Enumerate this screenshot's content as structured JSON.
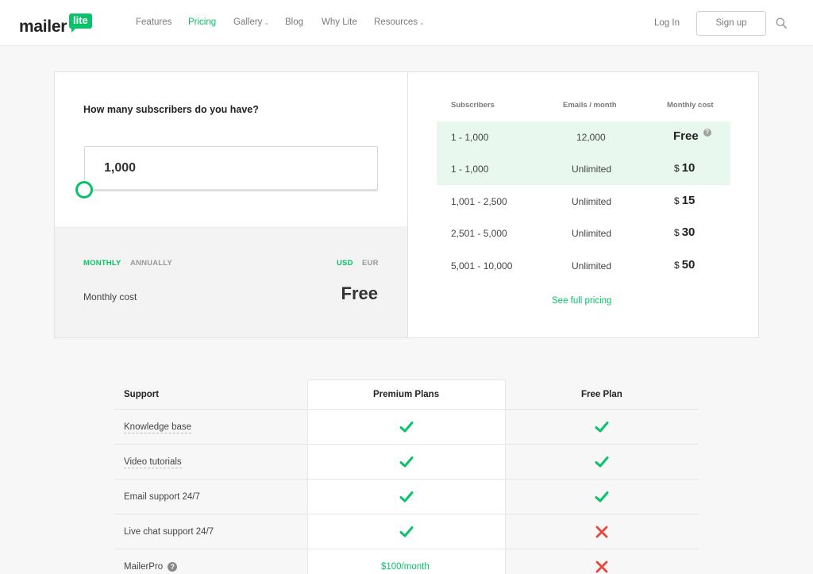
{
  "brand": {
    "logo_text": "mailer",
    "logo_badge": "lite",
    "accent": "#09c269"
  },
  "nav": {
    "items": [
      {
        "label": "Features",
        "active": false
      },
      {
        "label": "Pricing",
        "active": true
      },
      {
        "label": "Gallery",
        "active": false,
        "dropdown": true
      },
      {
        "label": "Blog",
        "active": false
      },
      {
        "label": "Why Lite",
        "active": false
      },
      {
        "label": "Resources",
        "active": false,
        "dropdown": true
      }
    ],
    "login_label": "Log In",
    "signup_label": "Sign up",
    "search_icon": "search-icon"
  },
  "calculator": {
    "question": "How many subscribers do you have?",
    "subscribers_value": "1,000",
    "billing": {
      "monthly_label": "MONTHLY",
      "annually_label": "ANNUALLY",
      "selected": "MONTHLY"
    },
    "currency": {
      "usd_label": "USD",
      "eur_label": "EUR",
      "selected": "USD"
    },
    "monthly_cost_label": "Monthly cost",
    "monthly_cost_value": "Free"
  },
  "pricing_table": {
    "headers": [
      "Subscribers",
      "Emails / month",
      "Monthly cost"
    ],
    "rows": [
      {
        "subscribers": "1 - 1,000",
        "emails": "12,000",
        "currency": "",
        "cost": "Free",
        "highlight": true,
        "help": "?"
      },
      {
        "subscribers": "1 - 1,000",
        "emails": "Unlimited",
        "currency": "$",
        "cost": "10",
        "highlight": true
      },
      {
        "subscribers": "1,001 - 2,500",
        "emails": "Unlimited",
        "currency": "$",
        "cost": "15",
        "highlight": false
      },
      {
        "subscribers": "2,501 - 5,000",
        "emails": "Unlimited",
        "currency": "$",
        "cost": "30",
        "highlight": false
      },
      {
        "subscribers": "5,001 - 10,000",
        "emails": "Unlimited",
        "currency": "$",
        "cost": "50",
        "highlight": false
      }
    ],
    "see_full_pricing": "See full pricing"
  },
  "compare": {
    "header": {
      "section": "Support",
      "premium": "Premium Plans",
      "free": "Free Plan"
    },
    "rows": [
      {
        "label": "Knowledge base",
        "premium": "check",
        "free": "check"
      },
      {
        "label": "Video tutorials",
        "premium": "check",
        "free": "check"
      },
      {
        "label": "Email support 24/7",
        "premium": "check",
        "free": "check"
      },
      {
        "label": "Live chat support 24/7",
        "premium": "check",
        "free": "cross"
      },
      {
        "label": "MailerPro",
        "premium_text": "$100/month",
        "free": "cross",
        "help": "?"
      }
    ]
  }
}
